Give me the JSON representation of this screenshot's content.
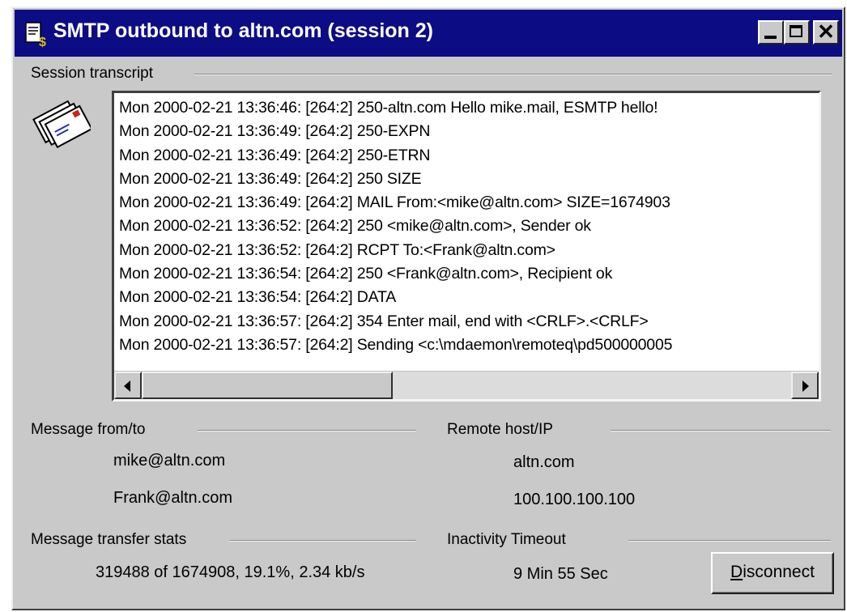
{
  "window": {
    "title": "SMTP outbound to altn.com (session 2)",
    "icon": "document-s-icon"
  },
  "transcript": {
    "label": "Session transcript",
    "icon": "envelopes-icon",
    "lines": [
      "Mon 2000-02-21 13:36:46: [264:2] 250-altn.com Hello mike.mail, ESMTP hello!",
      "Mon 2000-02-21 13:36:49: [264:2] 250-EXPN",
      "Mon 2000-02-21 13:36:49: [264:2] 250-ETRN",
      "Mon 2000-02-21 13:36:49: [264:2] 250 SIZE",
      "Mon 2000-02-21 13:36:49: [264:2] MAIL From:<mike@altn.com> SIZE=1674903",
      "Mon 2000-02-21 13:36:52: [264:2] 250 <mike@altn.com>, Sender ok",
      "Mon 2000-02-21 13:36:52: [264:2] RCPT To:<Frank@altn.com>",
      "Mon 2000-02-21 13:36:54: [264:2] 250 <Frank@altn.com>, Recipient ok",
      "Mon 2000-02-21 13:36:54: [264:2] DATA",
      "Mon 2000-02-21 13:36:57: [264:2] 354 Enter mail, end with <CRLF>.<CRLF>",
      "Mon 2000-02-21 13:36:57: [264:2] Sending <c:\\mdaemon\\remoteq\\pd500000005"
    ]
  },
  "message_fromto": {
    "label": "Message from/to",
    "from": "mike@altn.com",
    "to": "Frank@altn.com"
  },
  "remote_host": {
    "label": "Remote host/IP",
    "host": "altn.com",
    "ip": "100.100.100.100"
  },
  "transfer_stats": {
    "label": "Message transfer stats",
    "value": "319488 of 1674908, 19.1%, 2.34 kb/s"
  },
  "inactivity": {
    "label": "Inactivity Timeout",
    "value": "9 Min 55 Sec"
  },
  "disconnect": {
    "mnemonic": "D",
    "rest": "isconnect"
  }
}
